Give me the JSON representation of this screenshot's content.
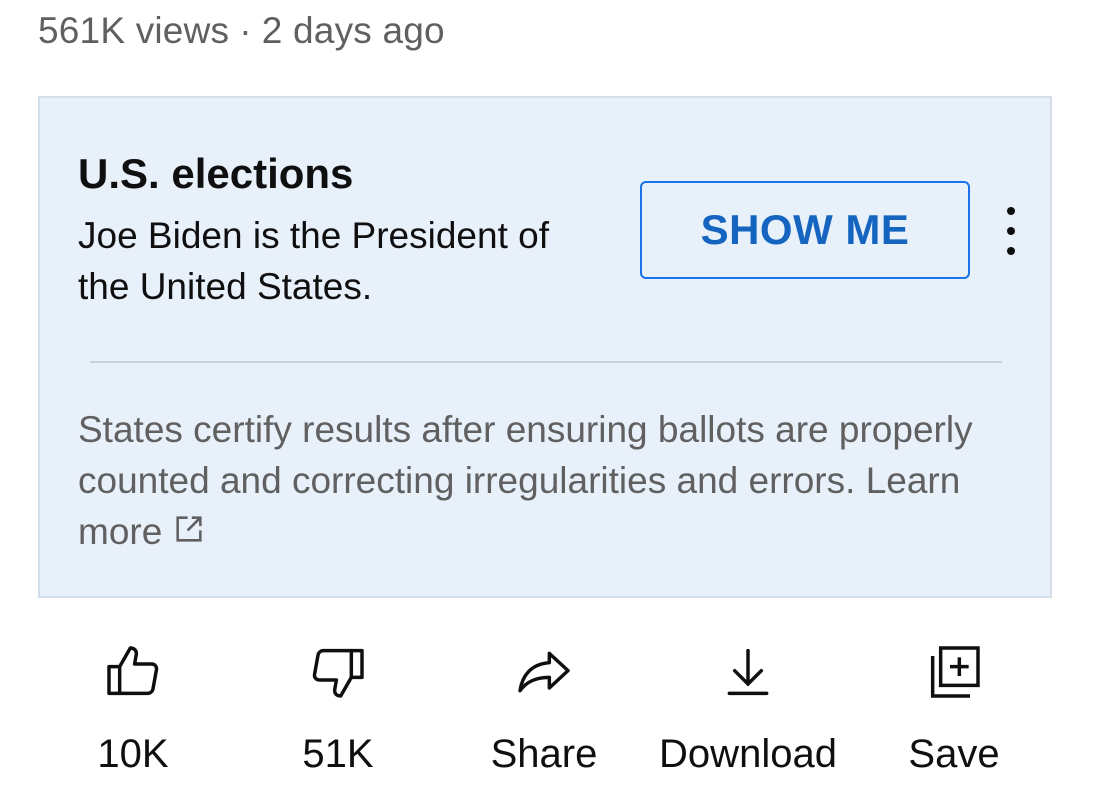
{
  "video_meta": {
    "views": "561K views",
    "separator": "·",
    "age": "2 days ago"
  },
  "info_panel": {
    "title": "U.S. elections",
    "body": "Joe Biden is the President of the United States.",
    "button_label": "SHOW ME",
    "note": "States certify results after ensuring ballots are properly counted and correcting irregularities and errors.",
    "link_label": "Learn more",
    "colors": {
      "panel_bg": "#e8f0fa",
      "button_accent": "#1565c0"
    }
  },
  "actions": [
    {
      "icon": "thumb-up-icon",
      "label": "10K"
    },
    {
      "icon": "thumb-down-icon",
      "label": "51K"
    },
    {
      "icon": "share-icon",
      "label": "Share"
    },
    {
      "icon": "download-icon",
      "label": "Download"
    },
    {
      "icon": "save-icon",
      "label": "Save"
    }
  ]
}
